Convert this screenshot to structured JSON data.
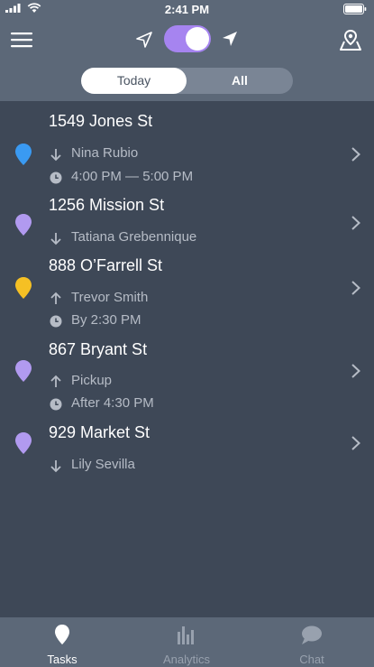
{
  "status_bar": {
    "time": "2:41 PM",
    "icons": [
      "signal-icon",
      "wifi-icon",
      "battery-icon"
    ]
  },
  "header": {
    "menu_icon": "hamburger-menu-icon",
    "nav_left_icon": "navigation-arrow-outline-icon",
    "toggle_on": true,
    "nav_right_icon": "navigation-arrow-filled-icon",
    "map_icon": "map-pin-icon",
    "segments": [
      {
        "label": "Today",
        "selected": true
      },
      {
        "label": "All",
        "selected": false
      }
    ]
  },
  "colors": {
    "header_bg": "#5c6878",
    "list_bg": "#3e4857",
    "toggle": "#a684f0",
    "pin_blue": "#3a9af2",
    "pin_purple": "#b19af0",
    "pin_yellow": "#f5c024"
  },
  "tasks": [
    {
      "address": "1549 Jones St",
      "pin_color": "#3a9af2",
      "direction": "down",
      "person": "Nina Rubio",
      "time": "4:00 PM — 5:00 PM"
    },
    {
      "address": "1256 Mission St",
      "pin_color": "#b19af0",
      "direction": "down",
      "person": "Tatiana Grebennique"
    },
    {
      "address": "888 O’Farrell St",
      "pin_color": "#f5c024",
      "direction": "up",
      "person": "Trevor Smith",
      "time": "By 2:30 PM"
    },
    {
      "address": "867 Bryant St",
      "pin_color": "#b19af0",
      "direction": "up",
      "person": "Pickup",
      "time": "After 4:30 PM"
    },
    {
      "address": "929 Market St",
      "pin_color": "#b19af0",
      "direction": "down",
      "person": "Lily Sevilla"
    }
  ],
  "tab_bar": {
    "tabs": [
      {
        "label": "Tasks",
        "icon": "pin-icon",
        "active": true
      },
      {
        "label": "Analytics",
        "icon": "bar-chart-icon",
        "active": false
      },
      {
        "label": "Chat",
        "icon": "chat-bubble-icon",
        "active": false
      }
    ]
  }
}
